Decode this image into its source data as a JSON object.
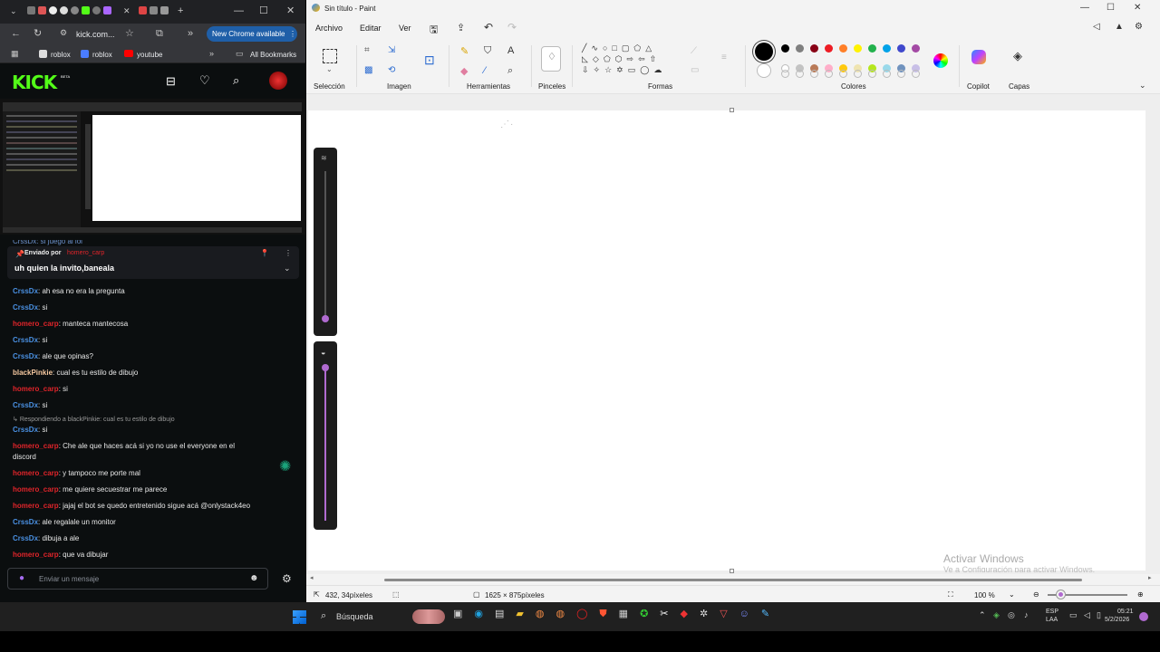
{
  "chrome": {
    "address": "kick.com...",
    "update_label": "New Chrome available",
    "bookmarks": [
      "roblox",
      "roblox",
      "youtube"
    ],
    "all_bookmarks": "All Bookmarks"
  },
  "kick": {
    "logo": "KICK",
    "beta": "BETA",
    "partial_top": "CrssDx: si juego al lol",
    "pinned_by_label": "Enviado por",
    "pinned_by_user": "homero_carp",
    "pinned_text": "uh quien la invito,baneala",
    "reply_label": "Respondiendo a blackPinkie: cual es tu estilo de dibujo",
    "messages": [
      {
        "user": "CrssDx",
        "color": "#4a90e2",
        "text": ": ah esa no era la pregunta"
      },
      {
        "user": "CrssDx",
        "color": "#4a90e2",
        "text": ": si"
      },
      {
        "user": "homero_carp",
        "color": "#e0242a",
        "text": ": manteca mantecosa"
      },
      {
        "user": "CrssDx",
        "color": "#4a90e2",
        "text": ": si"
      },
      {
        "user": "CrssDx",
        "color": "#4a90e2",
        "text": ": ale que opinas?"
      },
      {
        "user": "blackPinkie",
        "color": "#f5c8a0",
        "text": ": cual es tu estilo de dibujo"
      },
      {
        "user": "homero_carp",
        "color": "#e0242a",
        "text": ": si"
      },
      {
        "user": "CrssDx",
        "color": "#4a90e2",
        "text": ": si"
      },
      {
        "user": "CrssDx",
        "color": "#4a90e2",
        "text": ": si"
      },
      {
        "user": "homero_carp",
        "color": "#e0242a",
        "text": ": Che ale que haces acá si yo no use el everyone en el"
      },
      {
        "user": "",
        "color": "#e8e8e8",
        "text": "discord"
      },
      {
        "user": "homero_carp",
        "color": "#e0242a",
        "text": ": y tampoco me porte mal"
      },
      {
        "user": "homero_carp",
        "color": "#e0242a",
        "text": ": me quiere secuestrar me parece"
      },
      {
        "user": "homero_carp",
        "color": "#e0242a",
        "text": ": jajaj el bot se quedo entretenido sigue acá @onlystack4eo"
      },
      {
        "user": "CrssDx",
        "color": "#4a90e2",
        "text": ": ale regalale un monitor"
      },
      {
        "user": "CrssDx",
        "color": "#4a90e2",
        "text": ": dibuja a ale"
      },
      {
        "user": "homero_carp",
        "color": "#e0242a",
        "text": ": que va dibujar"
      }
    ],
    "input_placeholder": "Enviar un mensaje"
  },
  "paint": {
    "title": "Sin título - Paint",
    "menu": [
      "Archivo",
      "Editar",
      "Ver"
    ],
    "groups": [
      "Selección",
      "Imagen",
      "Herramientas",
      "Pinceles",
      "Formas",
      "Colores",
      "Copilot",
      "Capas"
    ],
    "status_pos": "432, 34píxeles",
    "status_size": "1625 × 875píxeles",
    "zoom": "100 %",
    "watermark_title": "Activar Windows",
    "watermark_sub": "Ve a Configuración para activar Windows.",
    "colors": [
      "#000000",
      "#7f7f7f",
      "#880015",
      "#ed1c24",
      "#ff7f27",
      "#fff200",
      "#22b14c",
      "#00a2e8",
      "#3f48cc",
      "#a349a4",
      "#ffffff",
      "#c3c3c3",
      "#b97a57",
      "#ffaec9",
      "#ffc90e",
      "#efe4b0",
      "#b5e61d",
      "#99d9ea",
      "#7092be",
      "#c8bfe7"
    ]
  },
  "taskbar": {
    "search": "Búsqueda",
    "lang1": "ESP",
    "lang2": "LAA",
    "time": "05:21",
    "date": "5/2/2026"
  }
}
